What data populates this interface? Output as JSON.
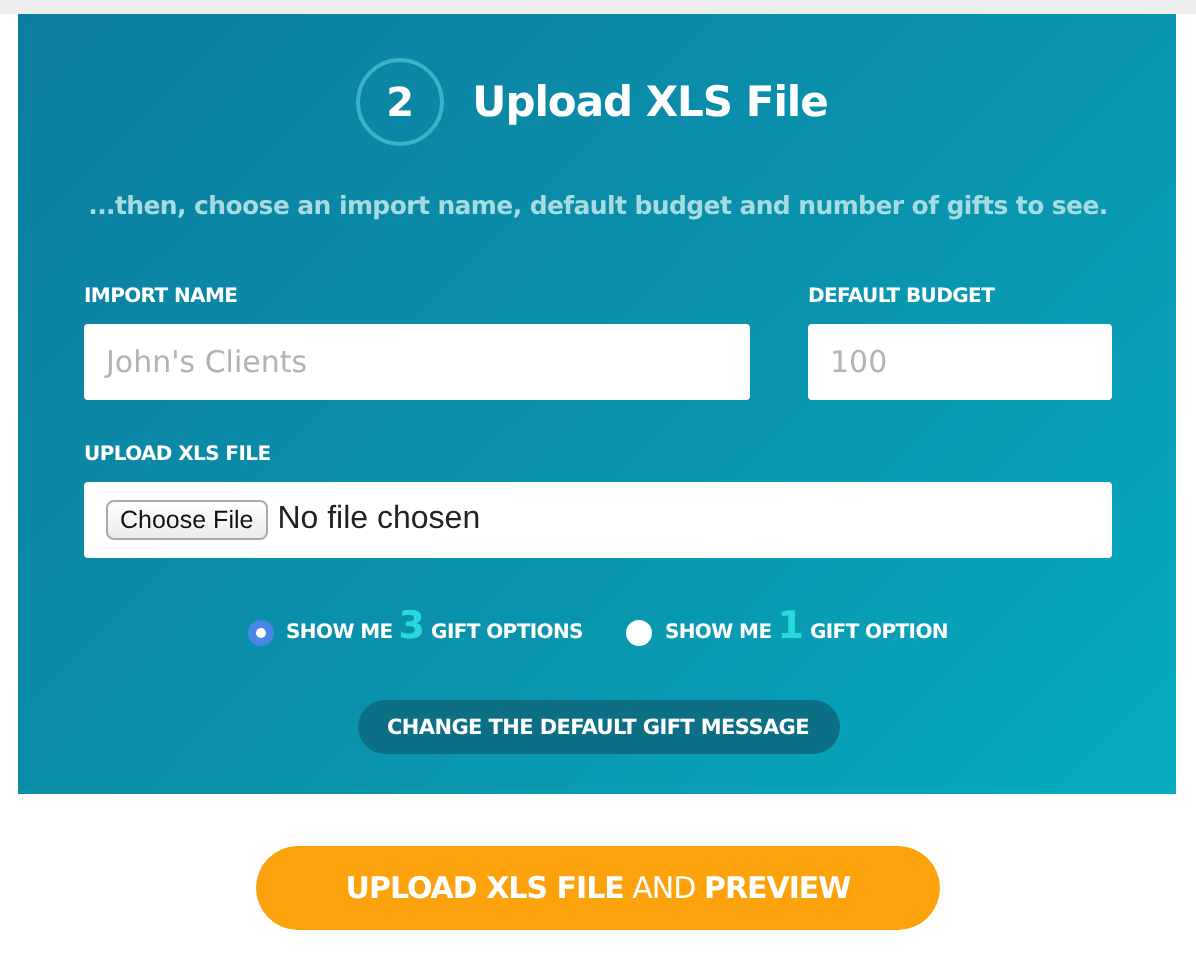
{
  "step": {
    "number": "2",
    "title": "Upload XLS File"
  },
  "subtitle": "...then, choose an import name, default budget and number of gifts to see.",
  "fields": [
    {
      "label": "IMPORT NAME",
      "placeholder": "John's Clients"
    },
    {
      "label": "DEFAULT BUDGET",
      "placeholder": "100"
    }
  ],
  "upload": {
    "label": "UPLOAD XLS FILE",
    "button": "Choose File",
    "status": "No file chosen"
  },
  "gift_options": [
    {
      "prefix": "SHOW ME",
      "count": "3",
      "suffix": "GIFT OPTIONS",
      "selected": true
    },
    {
      "prefix": "SHOW ME",
      "count": "1",
      "suffix": "GIFT OPTION",
      "selected": false
    }
  ],
  "message_button": "CHANGE THE DEFAULT GIFT MESSAGE",
  "submit_button": "**UPLOAD XLS FILE** AND **PREVIEW**"
}
